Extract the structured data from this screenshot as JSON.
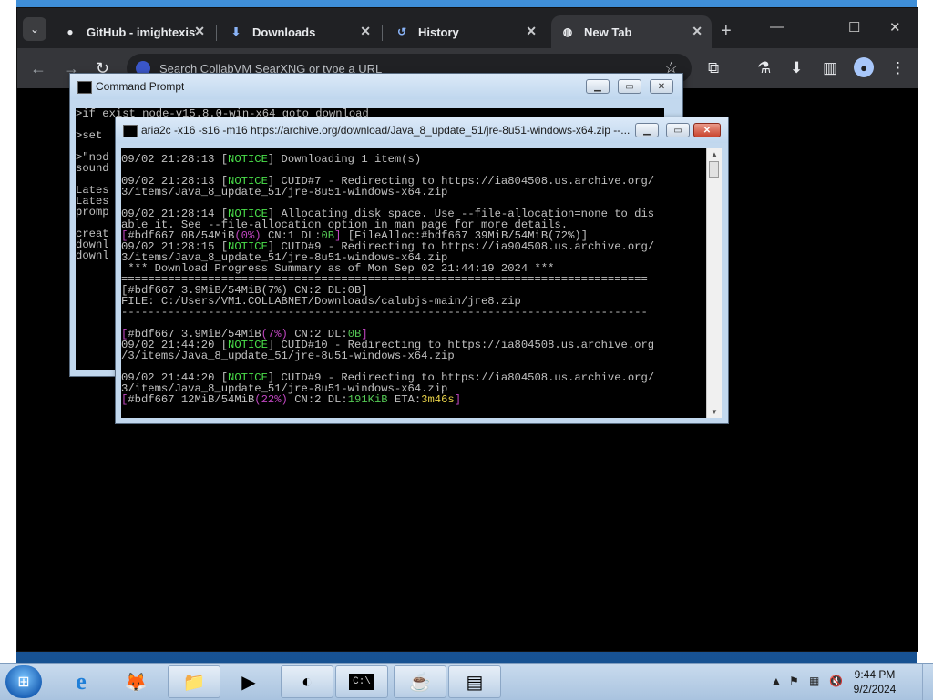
{
  "browser": {
    "tabs": [
      {
        "label": "GitHub - imightexist",
        "icon": "github-icon"
      },
      {
        "label": "Downloads",
        "icon": "download-icon"
      },
      {
        "label": "History",
        "icon": "history-icon"
      },
      {
        "label": "New Tab",
        "icon": "globe-icon",
        "active": true
      }
    ],
    "new_tab_label": "+",
    "window_controls": {
      "minimize": "—",
      "maximize": "☐",
      "close": "✕"
    },
    "omnibox_placeholder": "Search CollabVM SearXNG or type a URL"
  },
  "cmd_window": {
    "title": "Command Prompt",
    "lines": [
      ">if exist node-v15.8.0-win-x64 goto download",
      "",
      ">set",
      "",
      ">\"nod",
      "sound",
      "",
      "Lates",
      "Lates",
      "promp",
      "",
      "creat",
      "downl",
      "downl"
    ]
  },
  "aria_window": {
    "title": "aria2c  -x16 -s16 -m16 https://archive.org/download/Java_8_update_51/jre-8u51-windows-x64.zip --...",
    "lines": [
      [
        {
          "t": "09/02 21:28:13 ["
        },
        {
          "t": "NOTICE",
          "c": "g"
        },
        {
          "t": "] Downloading 1 item(s)"
        }
      ],
      [
        {
          "t": ""
        }
      ],
      [
        {
          "t": "09/02 21:28:13 ["
        },
        {
          "t": "NOTICE",
          "c": "g"
        },
        {
          "t": "] CUID#7 - Redirecting to https://ia804508.us.archive.org/"
        }
      ],
      [
        {
          "t": "3/items/Java_8_update_51/jre-8u51-windows-x64.zip"
        }
      ],
      [
        {
          "t": ""
        }
      ],
      [
        {
          "t": "09/02 21:28:14 ["
        },
        {
          "t": "NOTICE",
          "c": "g"
        },
        {
          "t": "] Allocating disk space. Use --file-allocation=none to dis"
        }
      ],
      [
        {
          "t": "able it. See --file-allocation option in man page for more details."
        }
      ],
      [
        {
          "t": "[",
          "c": "m"
        },
        {
          "t": "#bdf667 0B/54MiB"
        },
        {
          "t": "(0%)",
          "c": "m"
        },
        {
          "t": " CN:1 DL:"
        },
        {
          "t": "0B",
          "c": "lg"
        },
        {
          "t": "]",
          "c": "m"
        },
        {
          "t": " [FileAlloc:#bdf667 39MiB/54MiB(72%)]"
        }
      ],
      [
        {
          "t": "09/02 21:28:15 ["
        },
        {
          "t": "NOTICE",
          "c": "g"
        },
        {
          "t": "] CUID#9 - Redirecting to https://ia904508.us.archive.org/"
        }
      ],
      [
        {
          "t": "3/items/Java_8_update_51/jre-8u51-windows-x64.zip"
        }
      ],
      [
        {
          "t": " *** Download Progress Summary as of Mon Sep 02 21:44:19 2024 ***"
        }
      ],
      [
        {
          "t": "==============================================================================="
        }
      ],
      [
        {
          "t": "[#bdf667 3.9MiB/54MiB(7%) CN:2 DL:0B]"
        }
      ],
      [
        {
          "t": "FILE: C:/Users/VM1.COLLABNET/Downloads/calubjs-main/jre8.zip"
        }
      ],
      [
        {
          "t": "-------------------------------------------------------------------------------"
        }
      ],
      [
        {
          "t": ""
        }
      ],
      [
        {
          "t": "[",
          "c": "m"
        },
        {
          "t": "#bdf667 3.9MiB/54MiB"
        },
        {
          "t": "(7%)",
          "c": "m"
        },
        {
          "t": " CN:2 DL:"
        },
        {
          "t": "0B",
          "c": "lg"
        },
        {
          "t": "]",
          "c": "m"
        }
      ],
      [
        {
          "t": "09/02 21:44:20 ["
        },
        {
          "t": "NOTICE",
          "c": "g"
        },
        {
          "t": "] CUID#10 - Redirecting to https://ia804508.us.archive.org"
        }
      ],
      [
        {
          "t": "/3/items/Java_8_update_51/jre-8u51-windows-x64.zip"
        }
      ],
      [
        {
          "t": ""
        }
      ],
      [
        {
          "t": "09/02 21:44:20 ["
        },
        {
          "t": "NOTICE",
          "c": "g"
        },
        {
          "t": "] CUID#9 - Redirecting to https://ia804508.us.archive.org/"
        }
      ],
      [
        {
          "t": "3/items/Java_8_update_51/jre-8u51-windows-x64.zip"
        }
      ],
      [
        {
          "t": "[",
          "c": "m"
        },
        {
          "t": "#bdf667 12MiB/54MiB"
        },
        {
          "t": "(22%)",
          "c": "m"
        },
        {
          "t": " CN:2 DL:"
        },
        {
          "t": "191KiB",
          "c": "lg"
        },
        {
          "t": " ETA:"
        },
        {
          "t": "3m46s",
          "c": "y"
        },
        {
          "t": "]",
          "c": "m"
        }
      ]
    ]
  },
  "taskbar": {
    "items": [
      {
        "name": "internet-explorer",
        "glyph": "e",
        "open": false
      },
      {
        "name": "firefox",
        "glyph": "🦊",
        "open": false
      },
      {
        "name": "file-explorer",
        "glyph": "📁",
        "open": true
      },
      {
        "name": "media-player",
        "glyph": "▶",
        "open": false
      },
      {
        "name": "collabvm-app",
        "glyph": "◐",
        "open": true
      },
      {
        "name": "command-prompt",
        "glyph": "C:\\",
        "open": true
      },
      {
        "name": "java-setup",
        "glyph": "☕",
        "open": true
      },
      {
        "name": "notepad-window",
        "glyph": "▤",
        "open": true
      }
    ],
    "clock_time": "9:44 PM",
    "clock_date": "9/2/2024"
  }
}
